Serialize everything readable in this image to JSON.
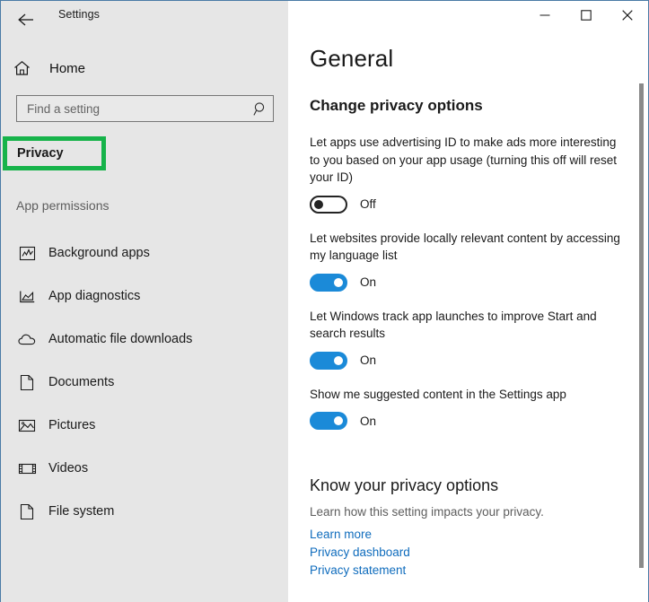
{
  "window": {
    "app_title": "Settings",
    "back_icon": "back-arrow-icon",
    "controls": {
      "minimize": "minimize-icon",
      "maximize": "maximize-icon",
      "close": "close-icon"
    },
    "border_color": "#4a7ba6"
  },
  "sidebar": {
    "home_label": "Home",
    "home_icon": "home-icon",
    "search": {
      "placeholder": "Find a setting",
      "value": "",
      "icon": "search-icon"
    },
    "selected_item": {
      "label": "Privacy",
      "highlight_color": "#16b34a"
    },
    "section_header": "App permissions",
    "items": [
      {
        "label": "Background apps",
        "icon": "background-apps-icon"
      },
      {
        "label": "App diagnostics",
        "icon": "app-diagnostics-icon"
      },
      {
        "label": "Automatic file downloads",
        "icon": "cloud-icon"
      },
      {
        "label": "Documents",
        "icon": "document-icon"
      },
      {
        "label": "Pictures",
        "icon": "picture-icon"
      },
      {
        "label": "Videos",
        "icon": "video-icon"
      },
      {
        "label": "File system",
        "icon": "file-system-icon"
      }
    ]
  },
  "main": {
    "page_title": "General",
    "section_title": "Change privacy options",
    "accent_color": "#1b8ad8",
    "link_color": "#0f6cbd",
    "settings": [
      {
        "description": "Let apps use advertising ID to make ads more interesting to you based on your app usage (turning this off will reset your ID)",
        "state": "Off",
        "on": false
      },
      {
        "description": "Let websites provide locally relevant content by accessing my language list",
        "state": "On",
        "on": true
      },
      {
        "description": "Let Windows track app launches to improve Start and search results",
        "state": "On",
        "on": true
      },
      {
        "description": "Show me suggested content in the Settings app",
        "state": "On",
        "on": true
      }
    ],
    "know_section": {
      "title": "Know your privacy options",
      "subtitle": "Learn how this setting impacts your privacy.",
      "links": [
        "Learn more",
        "Privacy dashboard",
        "Privacy statement"
      ]
    }
  }
}
